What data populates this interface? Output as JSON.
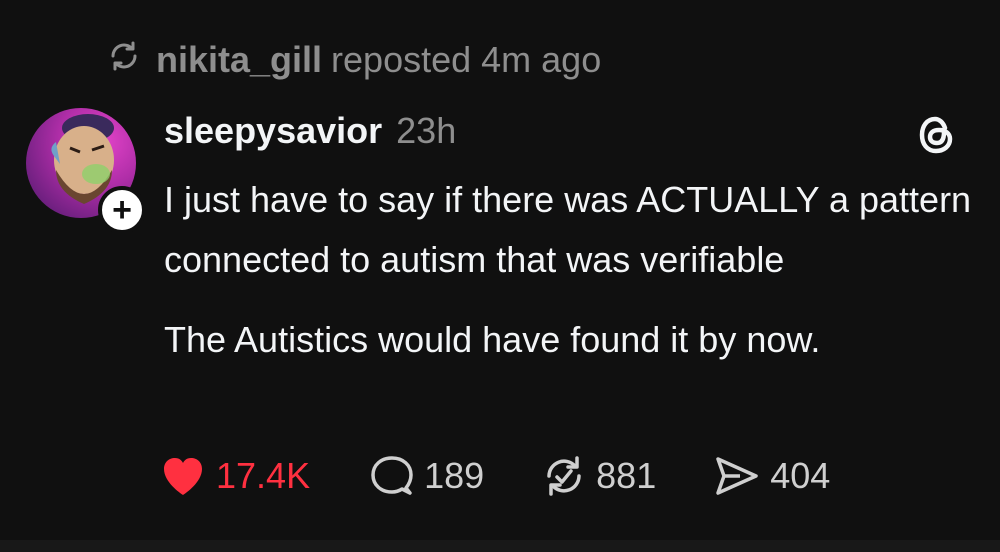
{
  "repost": {
    "username": "nikita_gill",
    "text": "reposted 4m ago"
  },
  "post": {
    "author": "sleepysavior",
    "time": "23h",
    "paragraphs": [
      "I just have to say if there was ACTUALLY a pattern connected to autism that was verifiable",
      "The Autistics would have found it by now."
    ]
  },
  "actions": {
    "likes": "17.4K",
    "comments": "189",
    "reposts": "881",
    "shares": "404"
  },
  "colors": {
    "background": "#101010",
    "like": "#ff3040",
    "muted": "#8e8e8e"
  }
}
